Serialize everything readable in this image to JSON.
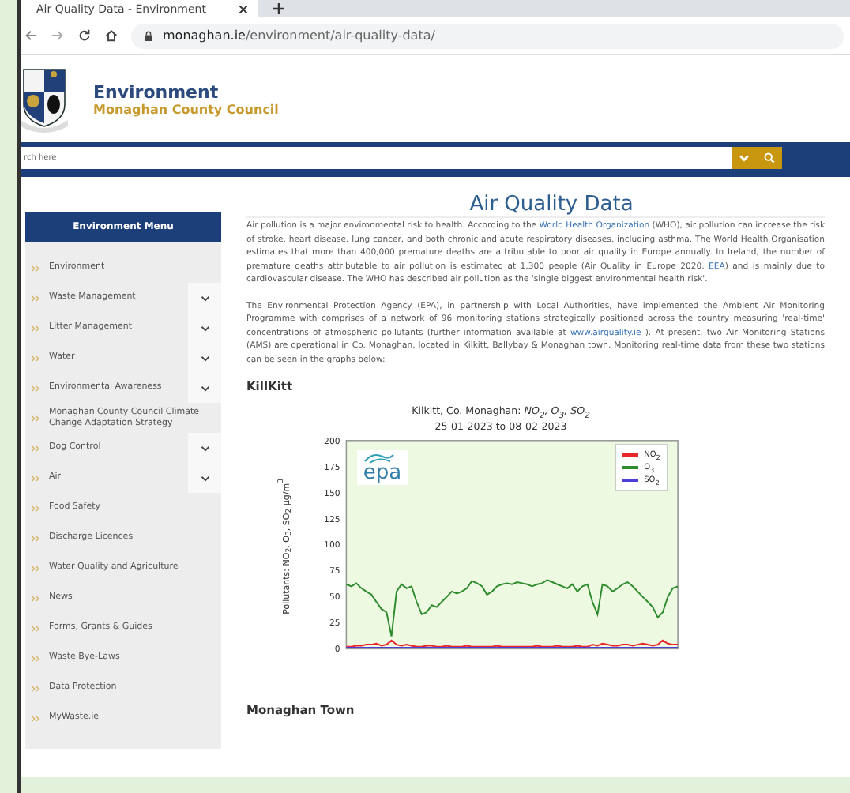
{
  "browser": {
    "tab_title": "Air Quality Data - Environment",
    "url_domain": "monaghan.ie",
    "url_path": "/environment/air-quality-data/"
  },
  "header": {
    "title": "Environment",
    "subtitle": "Monaghan County Council"
  },
  "search": {
    "placeholder": "rch here"
  },
  "sidebar": {
    "title": "Environment Menu",
    "items": [
      {
        "label": "Environment",
        "expandable": false
      },
      {
        "label": "Waste Management",
        "expandable": true
      },
      {
        "label": "Litter Management",
        "expandable": true
      },
      {
        "label": "Water",
        "expandable": true
      },
      {
        "label": "Environmental Awareness",
        "expandable": true
      },
      {
        "label": "Monaghan County Council Climate Change Adaptation Strategy",
        "expandable": false
      },
      {
        "label": "Dog Control",
        "expandable": true
      },
      {
        "label": "Air",
        "expandable": true
      },
      {
        "label": "Food Safety",
        "expandable": false
      },
      {
        "label": "Discharge Licences",
        "expandable": false
      },
      {
        "label": "Water Quality and Agriculture",
        "expandable": false
      },
      {
        "label": "News",
        "expandable": false
      },
      {
        "label": "Forms, Grants & Guides",
        "expandable": false
      },
      {
        "label": "Waste Bye-Laws",
        "expandable": false
      },
      {
        "label": "Data Protection",
        "expandable": false
      },
      {
        "label": "MyWaste.ie",
        "expandable": false
      }
    ]
  },
  "main": {
    "title": "Air Quality Data",
    "paragraphs": [
      [
        {
          "text": "Air pollution is a major environmental risk to health. According to the ",
          "link": false
        },
        {
          "text": "World Health Organization",
          "link": true
        },
        {
          "text": " (WHO), air pollution can increase the risk of stroke, heart disease, lung cancer, and both chronic and acute respiratory diseases, including asthma. The World Health Organisation estimates that more than 400,000 premature deaths are attributable to poor air quality in Europe annually. In Ireland, the number of premature deaths attributable to air pollution is estimated at 1,300 people (Air Quality in Europe 2020, ",
          "link": false
        },
        {
          "text": "EEA",
          "link": true
        },
        {
          "text": ") and is mainly due to cardiovascular disease. The WHO has described air pollution as the 'single biggest environmental health risk'.",
          "link": false
        }
      ],
      [
        {
          "text": "The Environmental Protection Agency (EPA), in partnership with Local Authorities, have implemented the Ambient Air Monitoring Programme with comprises of a network of 96 monitoring stations strategically positioned across the country measuring 'real-time' concentrations of atmospheric pollutants (further information available at ",
          "link": false
        },
        {
          "text": "www.airquality.ie",
          "link": true
        },
        {
          "text": " ). At present, two Air Monitoring Stations (AMS) are operational in Co. Monaghan, located in Kilkitt, Ballybay & Monaghan town. Monitoring real-time data from these two stations can be seen in the graphs below:",
          "link": false
        }
      ]
    ],
    "section_1": "KillKitt",
    "chart": {
      "title_lines": [
        "Kilkitt, Co. Monaghan: *NO$_{2}$, O$_{3}$, SO$_{2}$*",
        "25-01-2023 to 08-02-2023"
      ],
      "logo_text": "epa",
      "chart_data": {
        "type": "line",
        "legend": true,
        "ylabel": "Pollutants: NO$_{2}$, O$_{3}$, SO$_{2}$ µg/m$^{3}$",
        "ylim": [
          0,
          200
        ],
        "yticks": [
          0,
          25,
          50,
          75,
          100,
          125,
          150,
          175,
          200
        ],
        "series": [
          {
            "name": "NO$_{2}$",
            "color": "#e8262a",
            "values": [
              2,
              2,
              3,
              3,
              4,
              4,
              5,
              3,
              4,
              8,
              4,
              3,
              4,
              3,
              2,
              2,
              3,
              3,
              2,
              2,
              3,
              2,
              2,
              2,
              3,
              2,
              2,
              2,
              2,
              2,
              3,
              2,
              2,
              2,
              2,
              2,
              2,
              2,
              3,
              2,
              2,
              2,
              3,
              2,
              2,
              2,
              3,
              2,
              2,
              4,
              3,
              5,
              4,
              3,
              3,
              4,
              4,
              3,
              4,
              5,
              4,
              3,
              4,
              8,
              5,
              4,
              4
            ]
          },
          {
            "name": "O$_{3}$",
            "color": "#2e8b2e",
            "values": [
              62,
              60,
              63,
              58,
              55,
              52,
              45,
              38,
              35,
              12,
              55,
              62,
              58,
              60,
              45,
              33,
              35,
              42,
              40,
              45,
              50,
              55,
              53,
              55,
              58,
              65,
              63,
              60,
              52,
              55,
              60,
              62,
              63,
              62,
              64,
              63,
              62,
              60,
              62,
              63,
              66,
              64,
              62,
              60,
              58,
              62,
              55,
              60,
              62,
              45,
              33,
              62,
              60,
              55,
              58,
              62,
              64,
              60,
              55,
              50,
              45,
              40,
              30,
              35,
              50,
              58,
              60
            ]
          },
          {
            "name": "SO$_{2}$",
            "color": "#4b3fd6",
            "values": [
              1,
              1,
              1,
              1,
              1,
              1,
              1,
              1,
              1,
              1,
              1,
              1,
              1,
              1,
              1,
              1,
              1,
              1,
              1,
              1,
              1,
              1,
              1,
              1,
              1,
              1,
              1,
              1,
              1,
              1,
              1,
              1,
              1,
              1,
              1,
              1,
              1,
              1,
              1,
              1,
              1,
              1,
              1,
              1,
              1,
              1,
              1,
              1,
              1,
              1,
              1,
              1,
              1,
              1,
              1,
              1,
              1,
              1,
              1,
              1,
              1,
              1,
              1,
              1,
              1,
              1,
              1
            ]
          }
        ]
      }
    },
    "section_2": "Monaghan Town"
  }
}
